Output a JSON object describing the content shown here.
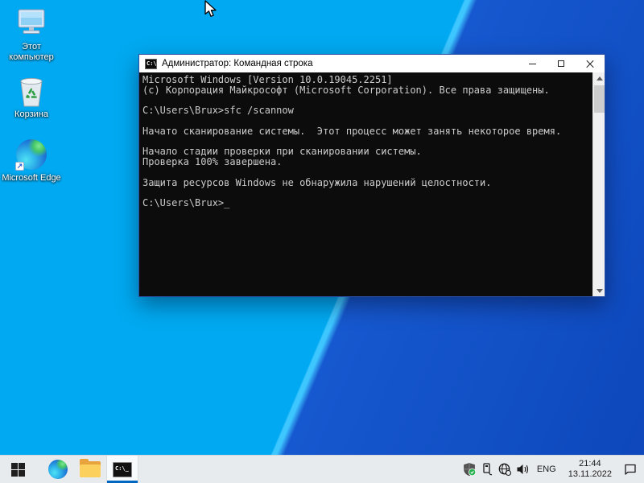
{
  "desktop": {
    "icons": [
      {
        "label": "Этот компьютер"
      },
      {
        "label": "Корзина"
      },
      {
        "label": "Microsoft Edge"
      }
    ]
  },
  "window": {
    "title": "Администратор: Командная строка"
  },
  "console": {
    "lines": [
      "Microsoft Windows [Version 10.0.19045.2251]",
      "(c) Корпорация Майкрософт (Microsoft Corporation). Все права защищены.",
      "",
      "C:\\Users\\Brux>sfc /scannow",
      "",
      "Начато сканирование системы.  Этот процесс может занять некоторое время.",
      "",
      "Начало стадии проверки при сканировании системы.",
      "Проверка 100% завершена.",
      "",
      "Защита ресурсов Windows не обнаружила нарушений целостности.",
      "",
      "C:\\Users\\Brux>"
    ],
    "cursor": "_"
  },
  "taskbar": {
    "tray": {
      "language": "ENG",
      "time": "21:44",
      "date": "13.11.2022"
    }
  },
  "colors": {
    "wallpaper_light": "#00a9f1",
    "wallpaper_dark": "#0d47bb",
    "taskbar_bg": "#e8ebee",
    "accent": "#0067c0",
    "console_bg": "#0c0c0c",
    "console_text": "#cccccc",
    "titlebar_bg": "#ffffff"
  }
}
